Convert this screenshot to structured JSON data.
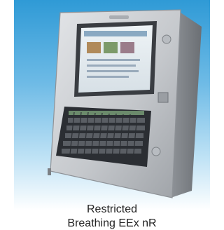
{
  "caption": {
    "line1": "Restricted",
    "line2": "Breathing EEx nR"
  },
  "colors": {
    "background_top": "#2f9ad6",
    "background_bottom": "#ffffff",
    "enclosure": "#c9ccd0",
    "keyboard": "#2b2e33"
  },
  "icons": [
    "enclosure-photo",
    "screen",
    "keyboard",
    "mounting-screw"
  ]
}
